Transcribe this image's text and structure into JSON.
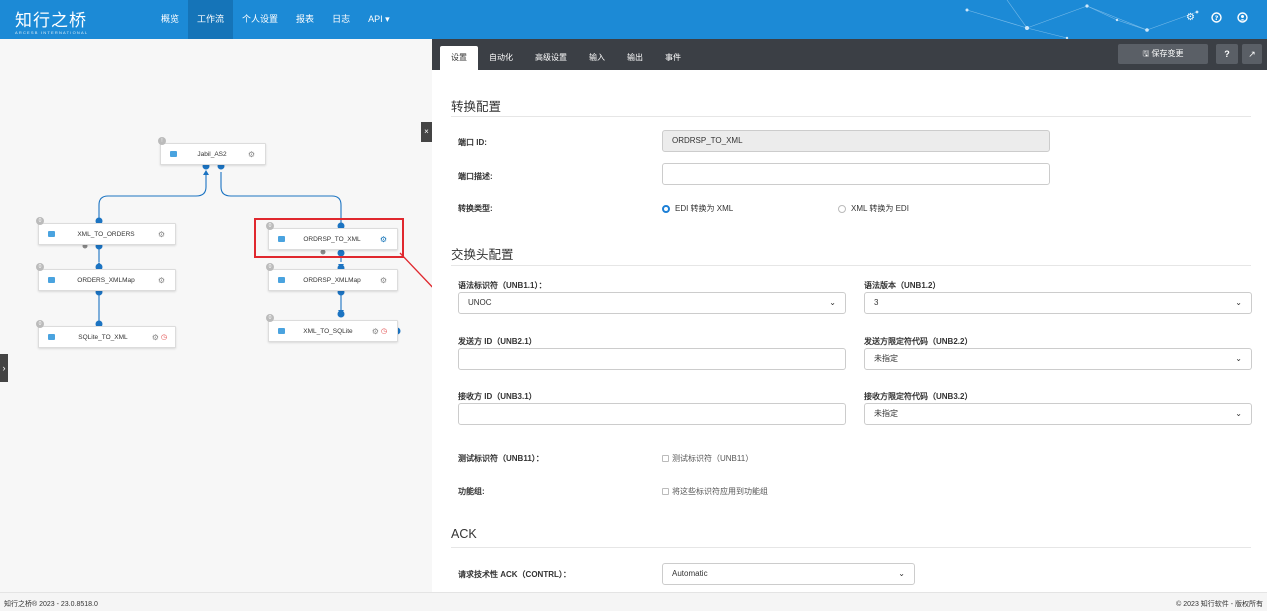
{
  "app": {
    "logo_main": "知行之桥",
    "logo_sub": "ARCESB INTERNATIONAL"
  },
  "nav": {
    "items": [
      "概览",
      "工作流",
      "个人设置",
      "报表",
      "日志",
      "API ▾"
    ]
  },
  "flow": {
    "nodes": [
      "Jabil_AS2",
      "XML_TO_ORDERS",
      "ORDRSP_TO_XML",
      "ORDERS_XMLMap",
      "ORDRSP_XMLMap",
      "SQLite_TO_XML",
      "XML_TO_SQLite"
    ]
  },
  "panel": {
    "tabs": [
      "设置",
      "自动化",
      "高级设置",
      "输入",
      "输出",
      "事件"
    ],
    "save_label": "🖫 保存变更"
  },
  "conversion": {
    "title": "转换配置",
    "port_id_label": "端口 ID:",
    "port_id_value": "ORDRSP_TO_XML",
    "port_desc_label": "端口描述:",
    "type_label": "转换类型:",
    "type_option_1": "EDI 转换为 XML",
    "type_option_2": "XML 转换为 EDI"
  },
  "exchange": {
    "title": "交换头配置",
    "syntax_id_label": "语法标识符（UNB1.1）：",
    "syntax_id_value": "UNOC",
    "syntax_ver_label": "语法版本（UNB1.2）",
    "syntax_ver_value": "3",
    "sender_id_label": "发送方 ID（UNB2.1）",
    "sender_qual_label": "发送方限定符代码（UNB2.2）",
    "sender_qual_value": "未指定",
    "receiver_id_label": "接收方 ID（UNB3.1）",
    "receiver_qual_label": "接收方限定符代码（UNB3.2）",
    "receiver_qual_value": "未指定",
    "test_label": "测试标识符（UNB11）：",
    "test_check": "测试标识符（UNB11）",
    "group_label": "功能组:",
    "group_check": "将这些标识符应用到功能组"
  },
  "ack": {
    "title": "ACK",
    "label": "请求技术性 ACK（CONTRL）：",
    "value": "Automatic"
  },
  "footer": {
    "left": "知行之桥® 2023 - 23.0.8518.0",
    "right": "© 2023 知行软件 - 版权所有"
  }
}
